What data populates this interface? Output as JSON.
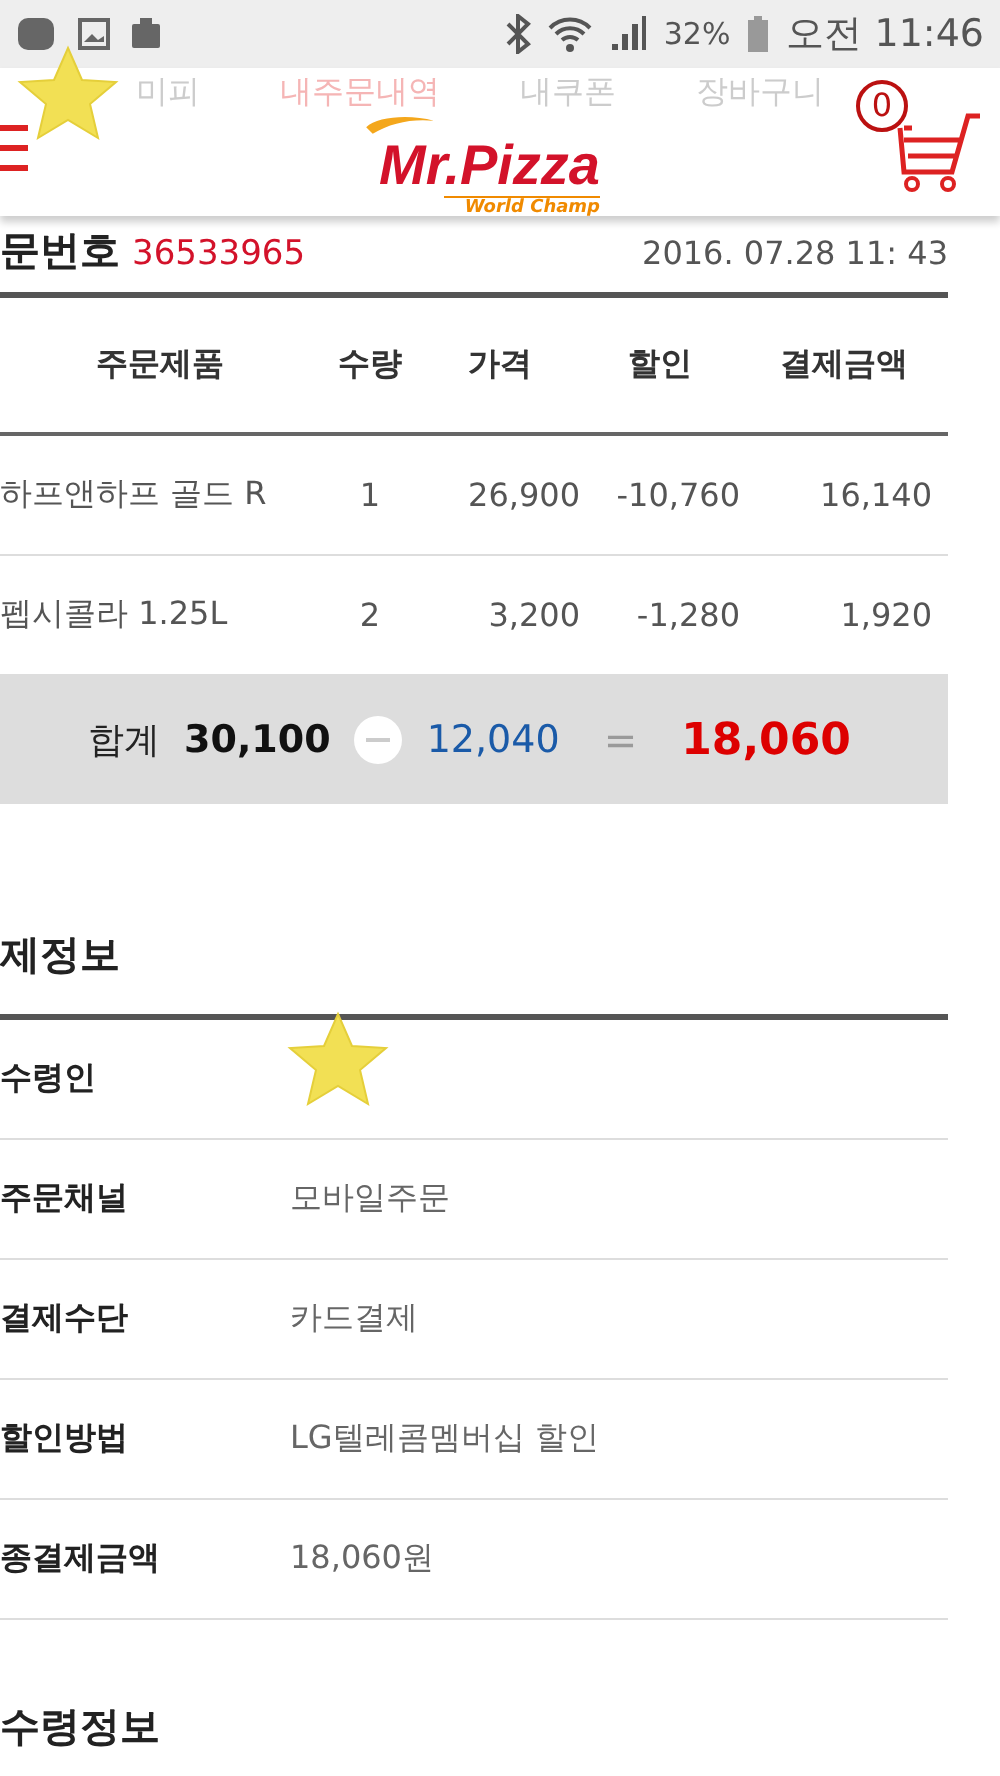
{
  "status_bar": {
    "battery": "32%",
    "time": "오전 11:46"
  },
  "header": {
    "tabs": [
      {
        "label": "미피",
        "selected": false
      },
      {
        "label": "내주문내역",
        "selected": true
      },
      {
        "label": "내쿠폰",
        "selected": false
      },
      {
        "label": "장바구니",
        "selected": false
      }
    ],
    "logo": {
      "name": "Mr.Pizza",
      "tagline": "World Champ"
    },
    "cart_count": "0"
  },
  "order": {
    "label": "문번호",
    "number": "36533965",
    "date": "2016. 07.28 11: 43"
  },
  "table": {
    "columns": [
      "주문제품",
      "수량",
      "가격",
      "할인",
      "결제금액"
    ],
    "rows": [
      [
        "하프앤하프 골드 R",
        "1",
        "26,900",
        "-10,760",
        "16,140"
      ],
      [
        "펩시콜라 1.25L",
        "2",
        "3,200",
        "-1,280",
        "1,920"
      ]
    ],
    "total": {
      "label": "합계",
      "sum": "30,100",
      "discount": "12,040",
      "equals": "=",
      "final": "18,060"
    }
  },
  "payment": {
    "title": "제정보",
    "rows": [
      {
        "label": "수령인"
      },
      {
        "label": "주문채널",
        "value": "모바일주문"
      },
      {
        "label": "결제수단",
        "value": "카드결제"
      },
      {
        "label": "할인방법",
        "value": "LG텔레콤멤버십 할인"
      },
      {
        "label": "종결제금액",
        "value": "18,060원"
      }
    ]
  },
  "next_section": {
    "title": "수령정보"
  }
}
